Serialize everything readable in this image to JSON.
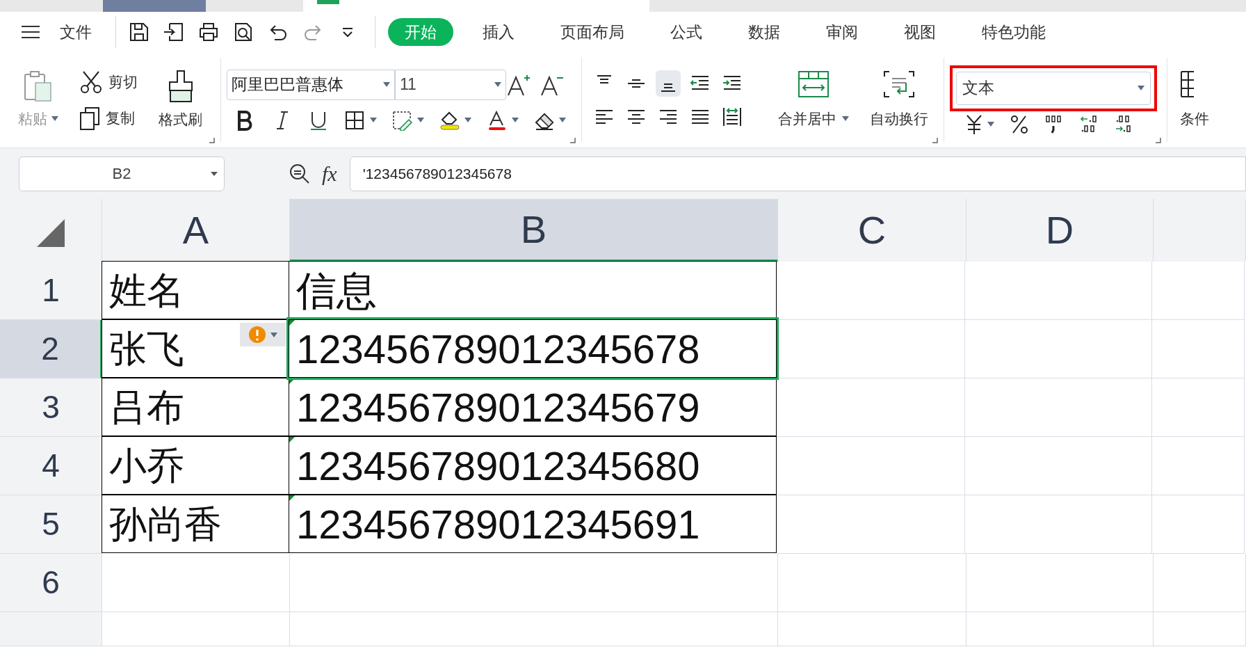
{
  "menu": {
    "file_label": "文件",
    "tabs": [
      {
        "label": "开始",
        "selected": true
      },
      {
        "label": "插入",
        "selected": false
      },
      {
        "label": "页面布局",
        "selected": false
      },
      {
        "label": "公式",
        "selected": false
      },
      {
        "label": "数据",
        "selected": false
      },
      {
        "label": "审阅",
        "selected": false
      },
      {
        "label": "视图",
        "selected": false
      },
      {
        "label": "特色功能",
        "selected": false
      }
    ]
  },
  "ribbon": {
    "paste": "粘贴",
    "cut": "剪切",
    "copy": "复制",
    "format_painter": "格式刷",
    "font_name": "阿里巴巴普惠体",
    "font_size": "11",
    "merge_center": "合并居中",
    "wrap_text": "自动换行",
    "number_format": {
      "value": "文本",
      "highlighted": true
    },
    "conditional": "条件"
  },
  "formula_bar": {
    "name_box": "B2",
    "fx_label": "fx",
    "formula": "'123456789012345678"
  },
  "columns": [
    {
      "label": "A",
      "selected": false
    },
    {
      "label": "B",
      "selected": true
    },
    {
      "label": "C",
      "selected": false
    },
    {
      "label": "D",
      "selected": false
    },
    {
      "selected": false
    }
  ],
  "rows": [
    {
      "header": "1",
      "selected": false,
      "cells": [
        {
          "text": "姓名",
          "warning": false,
          "text_number": false
        },
        {
          "text": "信息",
          "warning": false,
          "text_number": false,
          "selected": false
        }
      ]
    },
    {
      "header": "2",
      "selected": true,
      "cells": [
        {
          "text": "张飞",
          "warning": true,
          "text_number": false
        },
        {
          "text": "123456789012345678",
          "warning": false,
          "text_number": true,
          "selected": true
        }
      ]
    },
    {
      "header": "3",
      "selected": false,
      "cells": [
        {
          "text": "吕布",
          "warning": false,
          "text_number": false
        },
        {
          "text": "123456789012345679",
          "warning": false,
          "text_number": true,
          "selected": false
        }
      ]
    },
    {
      "header": "4",
      "selected": false,
      "cells": [
        {
          "text": "小乔",
          "warning": false,
          "text_number": false
        },
        {
          "text": "123456789012345680",
          "warning": false,
          "text_number": true,
          "selected": false
        }
      ]
    },
    {
      "header": "5",
      "selected": false,
      "cells": [
        {
          "text": "孙尚香",
          "warning": false,
          "text_number": false
        },
        {
          "text": "123456789012345691",
          "warning": false,
          "text_number": true,
          "selected": false
        }
      ]
    },
    {
      "header": "6",
      "selected": false,
      "cells": []
    },
    {
      "selected": false,
      "cells": []
    }
  ]
}
